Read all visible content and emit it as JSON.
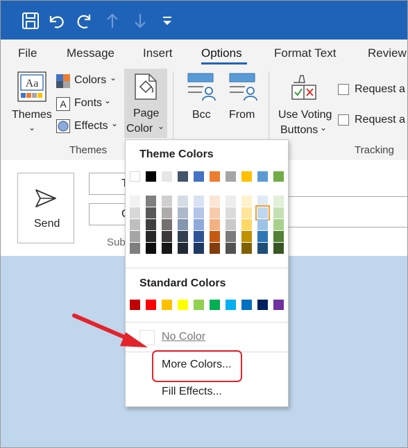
{
  "tabs": [
    "File",
    "Message",
    "Insert",
    "Options",
    "Format Text",
    "Review"
  ],
  "ribbon": {
    "themes_label": "Themes",
    "colors_label": "Colors",
    "fonts_label": "Fonts",
    "effects_label": "Effects",
    "page_color_line1": "Page",
    "page_color_line2": "Color",
    "bcc_label": "Bcc",
    "from_label": "From",
    "voting_line1": "Use Voting",
    "voting_line2": "Buttons",
    "request1": "Request a",
    "request2": "Request a",
    "group_themes": "Themes",
    "group_tracking": "Tracking",
    "sub_partial": "Sub"
  },
  "compose": {
    "send_label": "Send",
    "to_partial": "T",
    "cc_partial": "C"
  },
  "menu": {
    "theme_colors_heading": "Theme Colors",
    "standard_colors_heading": "Standard Colors",
    "no_color": "No Color",
    "more_colors": "More Colors...",
    "fill_effects": "Fill Effects...",
    "theme_top_row": [
      "#ffffff",
      "#000000",
      "#e7e6e6",
      "#44546a",
      "#4472c4",
      "#ed7d31",
      "#a5a5a5",
      "#ffc000",
      "#5b9bd5",
      "#70ad47"
    ],
    "theme_shades": [
      [
        "#f2f2f2",
        "#7f7f7f",
        "#d0cece",
        "#d6dce4",
        "#d9e2f3",
        "#fbe5d5",
        "#ededed",
        "#fff2cc",
        "#deebf6",
        "#e2efd9"
      ],
      [
        "#d8d8d8",
        "#595959",
        "#aeabab",
        "#adb9ca",
        "#b4c6e7",
        "#f7cbac",
        "#dbdbdb",
        "#fee599",
        "#bdd7ee",
        "#c5e0b3"
      ],
      [
        "#bfbfbf",
        "#3f3f3f",
        "#757070",
        "#8496b0",
        "#8eaadb",
        "#f4b183",
        "#c9c9c9",
        "#ffd965",
        "#9dc3e6",
        "#a8d08d"
      ],
      [
        "#a5a5a5",
        "#262626",
        "#3a3838",
        "#323f4f",
        "#2f5496",
        "#c45911",
        "#7b7b7b",
        "#bf9000",
        "#2e75b5",
        "#538135"
      ],
      [
        "#7f7f7f",
        "#0c0c0c",
        "#171616",
        "#222a35",
        "#1f3864",
        "#833c0b",
        "#525252",
        "#7f6000",
        "#1f4e79",
        "#375623"
      ]
    ],
    "standard_colors": [
      "#c00000",
      "#ff0000",
      "#ffc000",
      "#ffff00",
      "#92d050",
      "#00b050",
      "#00b0f0",
      "#0070c0",
      "#002060",
      "#7030a0"
    ]
  }
}
